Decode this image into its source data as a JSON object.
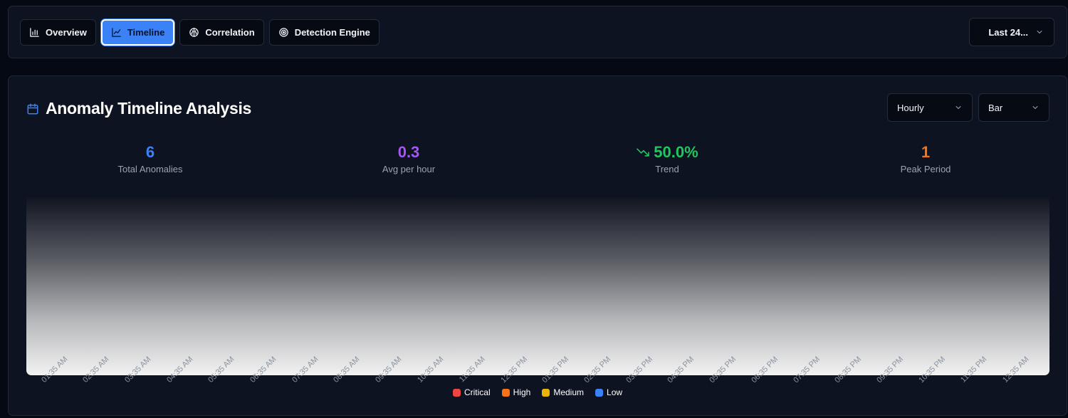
{
  "nav": {
    "tabs": [
      {
        "label": "Overview"
      },
      {
        "label": "Timeline"
      },
      {
        "label": "Correlation"
      },
      {
        "label": "Detection Engine"
      }
    ],
    "active_tab": "Timeline",
    "time_range": "Last 24..."
  },
  "panel": {
    "title": "Anomaly Timeline Analysis",
    "interval_select": "Hourly",
    "chart_type_select": "Bar"
  },
  "stats": [
    {
      "value": "6",
      "label": "Total Anomalies",
      "color": "#3b82f6"
    },
    {
      "value": "0.3",
      "label": "Avg per hour",
      "color": "#a855f7"
    },
    {
      "value": "50.0%",
      "label": "Trend",
      "color": "#22c55e",
      "icon": "trending-down-icon"
    },
    {
      "value": "1",
      "label": "Peak Period",
      "color": "#f97316"
    }
  ],
  "chart_data": {
    "type": "bar",
    "categories": [
      "01:35 AM",
      "02:35 AM",
      "03:35 AM",
      "04:35 AM",
      "05:35 AM",
      "06:35 AM",
      "07:35 AM",
      "08:35 AM",
      "09:35 AM",
      "10:35 AM",
      "11:35 AM",
      "12:35 PM",
      "01:35 PM",
      "02:35 PM",
      "03:35 PM",
      "04:35 PM",
      "05:35 PM",
      "06:35 PM",
      "07:35 PM",
      "08:35 PM",
      "09:35 PM",
      "10:35 PM",
      "11:35 PM",
      "12:35 AM"
    ],
    "series": [
      {
        "name": "Critical",
        "color": "#ef4444"
      },
      {
        "name": "High",
        "color": "#f97316"
      },
      {
        "name": "Medium",
        "color": "#eab308"
      },
      {
        "name": "Low",
        "color": "#3b82f6"
      }
    ]
  }
}
